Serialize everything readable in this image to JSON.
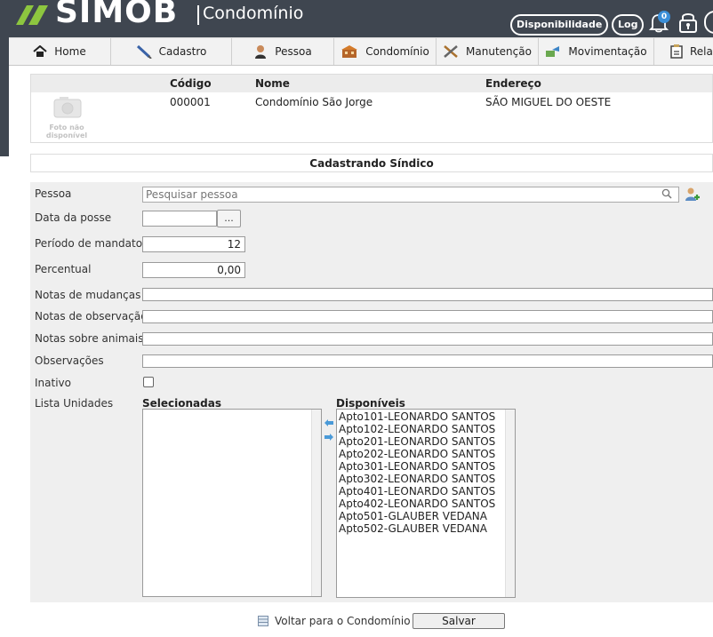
{
  "header": {
    "logo_text": "SIMOB",
    "logo_subtitle": "Condomínio",
    "availability_label": "Disponibilidade",
    "log_label": "Log",
    "notification_count": "0"
  },
  "nav": {
    "items": [
      {
        "label": "Home",
        "icon": "home-icon"
      },
      {
        "label": "Cadastro",
        "icon": "pencil-icon"
      },
      {
        "label": "Pessoa",
        "icon": "person-icon"
      },
      {
        "label": "Condomínio",
        "icon": "building-icon"
      },
      {
        "label": "Manutenção",
        "icon": "tools-icon"
      },
      {
        "label": "Movimentação",
        "icon": "movement-icon"
      },
      {
        "label": "Rela",
        "icon": "report-icon"
      }
    ]
  },
  "condo": {
    "photo_text_line1": "Foto não",
    "photo_text_line2": "disponível",
    "code_label": "Código",
    "name_label": "Nome",
    "address_label": "Endereço",
    "code": "000001",
    "name": "Condomínio São Jorge",
    "address": "SÃO MIGUEL DO OESTE"
  },
  "section_title": "Cadastrando Síndico",
  "form": {
    "pessoa_label": "Pessoa",
    "pessoa_placeholder": "Pesquisar pessoa",
    "data_posse_label": "Data da posse",
    "data_posse_value": "",
    "date_button_label": "...",
    "periodo_label": "Período de mandato",
    "periodo_value": "12",
    "percentual_label": "Percentual",
    "percentual_value": "0,00",
    "notas_mudancas_label": "Notas de mudanças",
    "notas_observacao_label": "Notas de observação",
    "notas_animais_label": "Notas sobre animais",
    "observacoes_label": "Observações",
    "inativo_label": "Inativo",
    "inativo_checked": false,
    "lista_unidades_label": "Lista Unidades"
  },
  "units": {
    "selected_title": "Selecionadas",
    "available_title": "Disponíveis",
    "selected": [],
    "available": [
      "Apto101-LEONARDO SANTOS",
      "Apto102-LEONARDO SANTOS",
      "Apto201-LEONARDO SANTOS",
      "Apto202-LEONARDO SANTOS",
      "Apto301-LEONARDO SANTOS",
      "Apto302-LEONARDO SANTOS",
      "Apto401-LEONARDO SANTOS",
      "Apto402-LEONARDO SANTOS",
      "Apto501-GLAUBER VEDANA",
      "Apto502-GLAUBER VEDANA"
    ]
  },
  "footer": {
    "back_label": "Voltar para o Condomínio",
    "save_label": "Salvar"
  },
  "colors": {
    "header_bg": "#3f4650",
    "logo_green": "#8dc63f",
    "badge_blue": "#3b8fd8",
    "form_bg": "#efefef"
  }
}
